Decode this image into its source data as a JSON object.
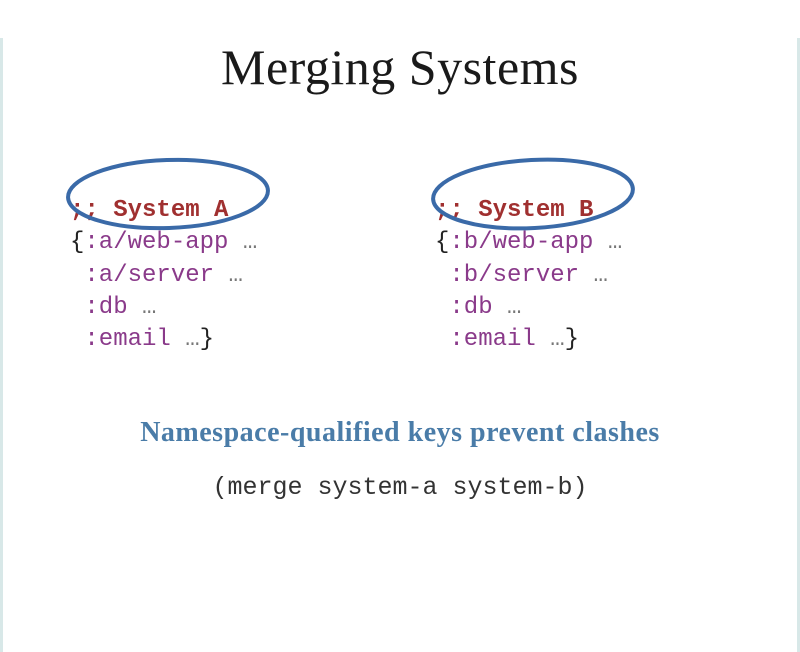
{
  "title": "Merging Systems",
  "systemA": {
    "comment": ";; System A",
    "line1_key": ":a/web-app",
    "line2_key": ":a/server",
    "line3_key": ":db",
    "line4_key": ":email"
  },
  "systemB": {
    "comment": ";; System B",
    "line1_key": ":b/web-app",
    "line2_key": ":b/server",
    "line3_key": ":db",
    "line4_key": ":email"
  },
  "ellipsis": "…",
  "open_brace": "{",
  "close_brace": "}",
  "annotation": "Namespace-qualified keys prevent clashes",
  "merge_call": "(merge system-a system-b)"
}
